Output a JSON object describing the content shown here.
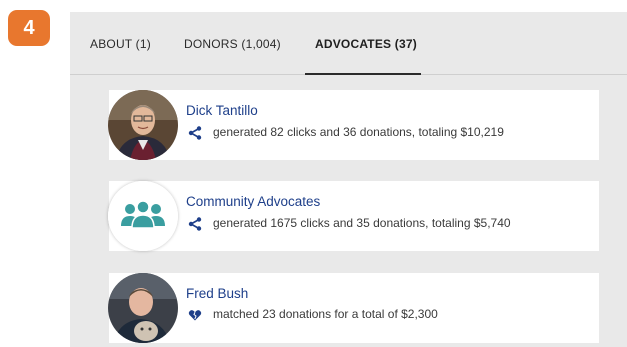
{
  "step_badge": "4",
  "tabs": [
    {
      "label": "ABOUT (1)"
    },
    {
      "label": "DONORS (1,004)"
    },
    {
      "label": "ADVOCATES (37)",
      "active": true
    }
  ],
  "advocates": [
    {
      "name": "Dick Tantillo",
      "icon": "share-icon",
      "stat": "generated 82 clicks and 36 donations, totaling $10,219"
    },
    {
      "name": "Community Advocates",
      "icon": "share-icon",
      "stat": "generated 1675 clicks and 35 donations, totaling $5,740"
    },
    {
      "name": "Fred Bush",
      "icon": "broken-heart-icon",
      "stat": "matched 23 donations for a total of $2,300"
    }
  ],
  "colors": {
    "badge": "#e8772e",
    "panel_bg": "#e9e9e9",
    "name_link": "#1e3f8a",
    "icon": "#1e3f8a",
    "group_icon": "#3a9ea0"
  }
}
